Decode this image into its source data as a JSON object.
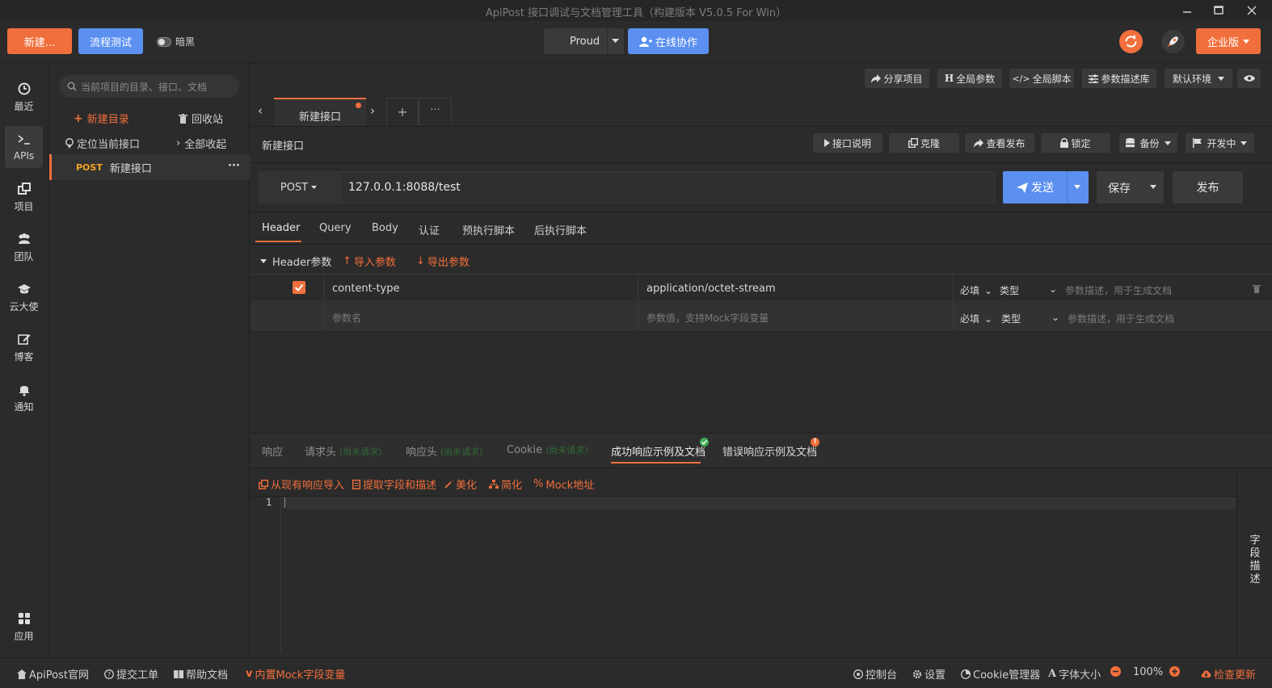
{
  "window": {
    "title": "ApiPost 接口调试与文档管理工具（构建版本 V5.0.5 For Win）"
  },
  "toolbar": {
    "new_label": "新建...",
    "flow_test_label": "流程测试",
    "dark_label": "暗黑",
    "workspace_label": "Proud",
    "collab_label": "在线协作",
    "enterprise_label": "企业版"
  },
  "leftnav": {
    "items": [
      {
        "label": "最近",
        "icon": "clock-icon"
      },
      {
        "label": "APIs",
        "icon": "terminal-icon"
      },
      {
        "label": "项目",
        "icon": "project-icon"
      },
      {
        "label": "团队",
        "icon": "team-icon"
      },
      {
        "label": "云大使",
        "icon": "graduation-cap-icon"
      },
      {
        "label": "博客",
        "icon": "edit-icon"
      },
      {
        "label": "通知",
        "icon": "bell-icon"
      }
    ],
    "apps_label": "应用"
  },
  "tree": {
    "search_placeholder": "当前项目的目录、接口、文档",
    "new_dir_label": "新建目录",
    "recycle_label": "回收站",
    "locate_label": "定位当前接口",
    "collapse_label": "全部收起",
    "items": [
      {
        "method": "POST",
        "name": "新建接口",
        "more": "···"
      }
    ]
  },
  "project_bar": {
    "share_label": "分享项目",
    "global_params_label": "全局参数",
    "global_script_label": "全局脚本",
    "param_desc_lib_label": "参数描述库",
    "env_label": "默认环境"
  },
  "tabs": [
    {
      "label": "新建接口"
    }
  ],
  "api": {
    "name": "新建接口",
    "doc_label": "接口说明",
    "clone_label": "克隆",
    "view_publish_label": "查看发布",
    "lock_label": "锁定",
    "backup_label": "备份",
    "status_label": "开发中",
    "method": "POST",
    "url": "127.0.0.1:8088/test",
    "send_label": "发送",
    "save_label": "保存",
    "publish_label": "发布"
  },
  "request_tabs": [
    "Header",
    "Query",
    "Body",
    "认证",
    "预执行脚本",
    "后执行脚本"
  ],
  "header_section": {
    "title": "Header参数",
    "import_label": "导入参数",
    "export_label": "导出参数",
    "rows": [
      {
        "checked": true,
        "key": "content-type",
        "value": "application/octet-stream",
        "required": "必填",
        "type": "类型",
        "desc_placeholder": "参数描述，用于生成文档"
      }
    ],
    "new_row": {
      "key_placeholder": "参数名",
      "value_placeholder": "参数值，支持Mock字段变量",
      "required": "必填",
      "type": "类型",
      "desc_placeholder": "参数描述，用于生成文档"
    }
  },
  "response_tabs": {
    "response": "响应",
    "req_headers": "请求头",
    "req_headers_note": "(尚未请求)",
    "resp_headers": "响应头",
    "resp_headers_note": "(尚未请求)",
    "cookie": "Cookie",
    "cookie_note": "(尚未请求)",
    "success_example": "成功响应示例及文档",
    "error_example": "错误响应示例及文档"
  },
  "example_toolbar": {
    "import_label": "从现有响应导入",
    "extract_label": "提取字段和描述",
    "beautify_label": "美化",
    "simplify_label": "简化",
    "mock_label": "Mock地址"
  },
  "editor": {
    "line_number": "1"
  },
  "field_desc_label": "字\n段\n描\n述",
  "statusbar": {
    "official_label": "ApiPost官网",
    "ticket_label": "提交工单",
    "help_label": "帮助文档",
    "mock_label": "内置Mock字段变量",
    "console_label": "控制台",
    "settings_label": "设置",
    "cookie_mgr_label": "Cookie管理器",
    "font_size_label": "字体大小",
    "zoom": "100%",
    "update_label": "检查更新"
  },
  "colors": {
    "accent": "#f16f3c",
    "blue": "#5b8ff0",
    "bg": "#2b2b2b"
  }
}
